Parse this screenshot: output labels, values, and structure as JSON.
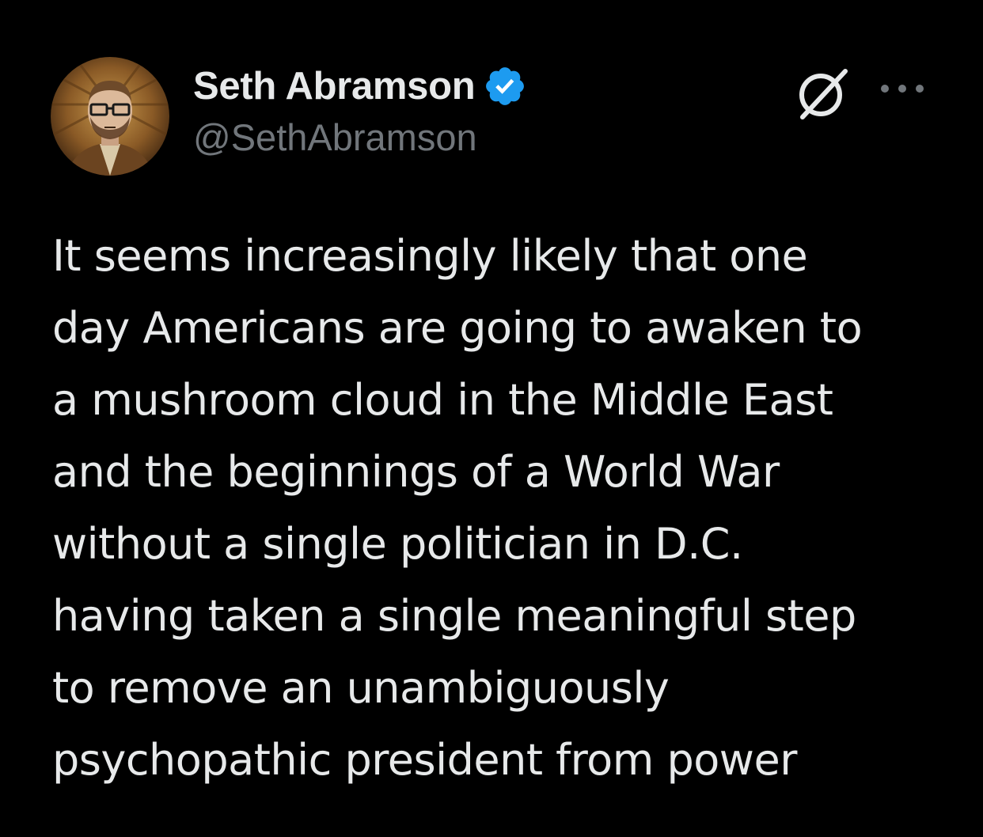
{
  "author": {
    "display_name": "Seth Abramson",
    "handle": "@SethAbramson",
    "verified": true,
    "verified_color": "#1d9bf0",
    "avatar_icon": "user-avatar"
  },
  "actions": {
    "grok_icon": "grok-icon",
    "more_icon": "more-options-icon"
  },
  "tweet": {
    "lines": [
      "It seems increasingly likely that one",
      "day Americans are going to awaken to",
      "a mushroom cloud in the Middle East",
      "and the beginnings of a World War",
      "without a single politician in D.C.",
      "having taken a single meaningful step",
      "to remove an unambiguously",
      "psychopathic president from power"
    ]
  },
  "colors": {
    "background": "#000000",
    "primary_text": "#e7e9ea",
    "secondary_text": "#71767b",
    "accent": "#1d9bf0"
  }
}
